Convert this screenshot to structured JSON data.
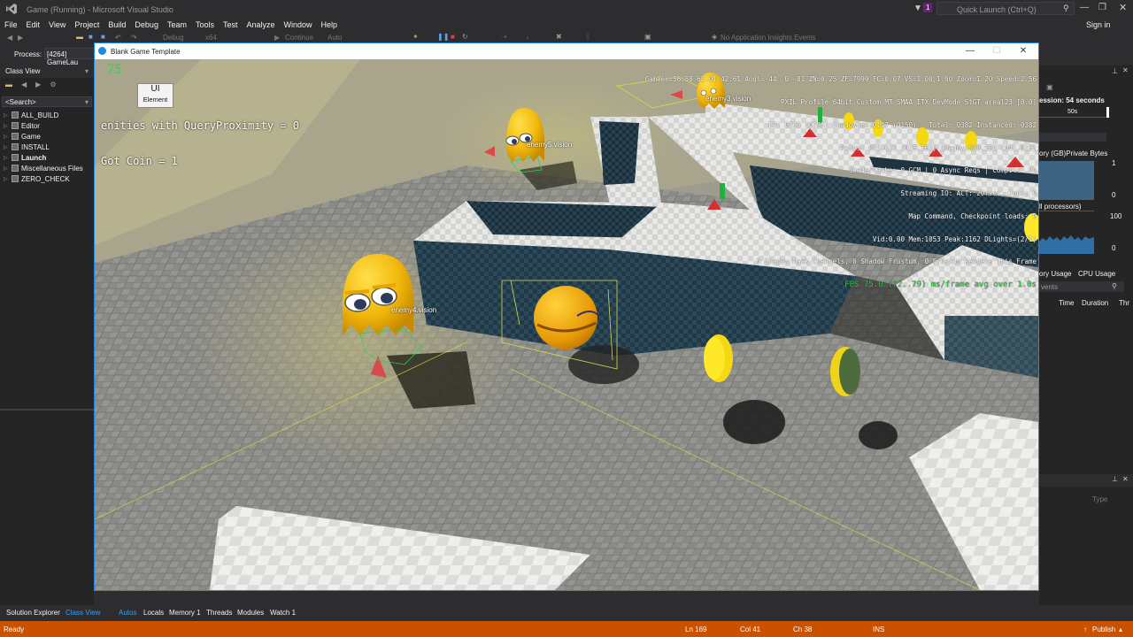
{
  "app": {
    "window_title": "Game (Running) - Microsoft Visual Studio",
    "quick_launch_placeholder": "Quick Launch (Ctrl+Q)",
    "notification_count": "1",
    "sign_in": "Sign in"
  },
  "menu": [
    "File",
    "Edit",
    "View",
    "Project",
    "Build",
    "Debug",
    "Team",
    "Tools",
    "Test",
    "Analyze",
    "Window",
    "Help"
  ],
  "toolbar": {
    "config": "Debug",
    "platform": "x64",
    "continue": "Continue",
    "auto": "Auto",
    "insights": "No Application Insights Events"
  },
  "process": {
    "label": "Process:",
    "value": "[4264] GameLau"
  },
  "class_view": {
    "title": "Class View",
    "search_placeholder": "<Search>",
    "items": [
      "ALL_BUILD",
      "Editor",
      "Game",
      "INSTALL",
      "Launch",
      "Miscellaneous Files",
      "ZERO_CHECK"
    ],
    "bold_item": "Launch"
  },
  "diag": {
    "session": "ession: 54 seconds",
    "tick": "50s",
    "memory_title": "ory (GB)Private Bytes",
    "mem_max": "1",
    "mem_min": "0",
    "cpu_title": "ll processors)",
    "cpu_max": "100",
    "cpu_min": "0",
    "tab_memory": "ory Usage",
    "tab_cpu": "CPU Usage",
    "events_placeholder": "vents",
    "col_time": "Time",
    "col_duration": "Duration",
    "col_thread": "Thr",
    "col_type": "Type"
  },
  "game_window": {
    "title": "Blank Game Template",
    "fps_corner": "75",
    "ui_element_line1": "UI",
    "ui_element_line2": "Element",
    "query_text": "enities with QueryProximity = 0",
    "coin_text": "Got Coin = 1",
    "stats": [
      "CamPos=56.58 62.01 42.61 Angl=-44  0 -81 ZN=0.25 ZF=7999 FC=0.07 VS=1.00,1.00 Zoom=1.20 Speed=2.56",
      "PXIL Profile 64bit Custom MT SMAA ITX DevMode StGT areal23 [0.0]",
      "DP: 0295 (0295) ShadowGen:0147 (0150) - Total: 0382 Instanced: 0382",
      "Polys: 075,621 (075,163) Shadow:038,528 (041,023)",
      "ShaderCache: 0 GCM | 0 Async Reqs | Compile: On",
      "Streaming IO: ACT: 20msec, Jobs: 0",
      "Map Command, Checkpoint loads: 0",
      "Vid:0.00 Mem:1053 Peak:1162 DLights=(2/1)",
      "0 Shadow Mask Channels, 0 Shadow Frustum, 0 Frustum Renders This Frame",
      "FPS 75.0 (72..79) ms/frame avg over 1.0s"
    ],
    "vision_labels": [
      "enemy3.vision",
      "enemy5.vision",
      "enemy4.vision"
    ]
  },
  "bottom_tabs": {
    "left": [
      "Solution Explorer",
      "Class View"
    ],
    "debug": [
      "Autos",
      "Locals",
      "Memory 1",
      "Threads",
      "Modules",
      "Watch 1"
    ]
  },
  "status": {
    "ready": "Ready",
    "ln": "Ln 169",
    "col": "Col 41",
    "ch": "Ch 38",
    "ins": "INS",
    "publish": "Publish"
  },
  "colors": {
    "vs_bg": "#2d2d30",
    "status_bar": "#ca5100",
    "accent": "#1e88e5",
    "enemy_yellow": "#f4c20d",
    "wall_dark": "#1f3340",
    "floor": "#8b8b86",
    "grass": "#bdb88c"
  }
}
